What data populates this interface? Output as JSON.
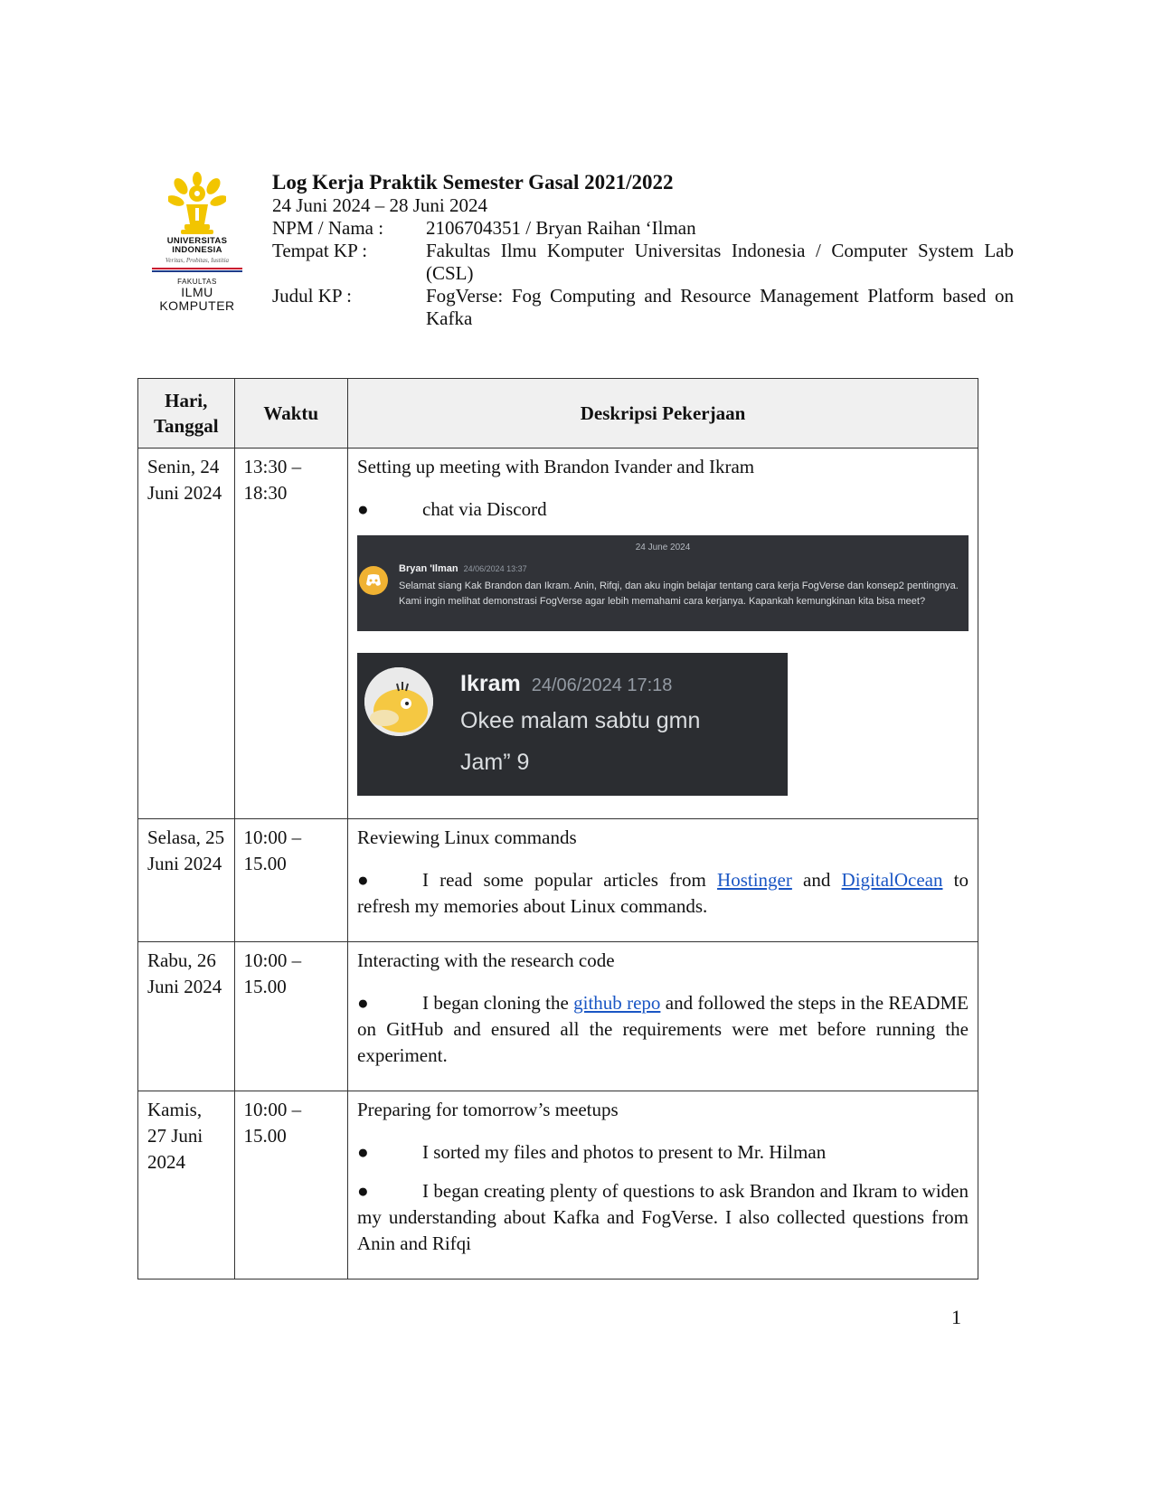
{
  "logo": {
    "university": "UNIVERSITAS INDONESIA",
    "university_line1": "UNIVERSITAS",
    "university_line2": "INDONESIA",
    "motto": "Veritas, Probitas, Iustitia",
    "faculty_small": "FAKULTAS",
    "faculty_line1": "ILMU",
    "faculty_line2": "KOMPUTER"
  },
  "header": {
    "title": "Log Kerja Praktik Semester Gasal 2021/2022",
    "period": "24 Juni 2024 – 28 Juni 2024",
    "npm_label": "NPM / Nama :",
    "npm_value": "2106704351 / Bryan Raihan ‘Ilman",
    "tempat_label": "Tempat KP :",
    "tempat_value": "Fakultas Ilmu Komputer Universitas Indonesia / Computer System Lab (CSL)",
    "judul_label": "Judul KP :",
    "judul_value": "FogVerse: Fog Computing and Resource Management Platform based on Kafka"
  },
  "table": {
    "headers": {
      "day_line1": "Hari,",
      "day_line2": "Tanggal",
      "time": "Waktu",
      "desc": "Deskripsi Pekerjaan"
    },
    "rows": [
      {
        "day": "Senin, 24 Juni 2024",
        "time": "13:30 – 18:30",
        "title": "Setting up meeting with Brandon Ivander and Ikram",
        "bullet1": "chat via Discord"
      },
      {
        "day": "Selasa, 25 Juni 2024",
        "time": "10:00 – 15.00",
        "title": "Reviewing Linux commands",
        "b_pre": "I read some popular articles from ",
        "b_link1": "Hostinger",
        "b_mid": " and ",
        "b_link2": "DigitalOcean",
        "b_post": " to refresh my memories about Linux commands."
      },
      {
        "day": "Rabu, 26 Juni 2024",
        "time": "10:00 – 15.00",
        "title": "Interacting with the research code",
        "b_pre": "I began cloning the ",
        "b_link": "github repo",
        "b_post": " and followed the steps in the README on GitHub and ensured all the requirements were met before running the experiment."
      },
      {
        "day": "Kamis, 27 Juni 2024",
        "time": "10:00 – 15.00",
        "title": "Preparing for tomorrow’s meetups",
        "bullet1": "I sorted my files and photos to present to Mr. Hilman",
        "bullet2": "I began creating plenty of questions to ask Brandon and Ikram to widen my understanding about Kafka and FogVerse. I also collected questions from Anin and Rifqi"
      }
    ],
    "bullet_symbol": "●"
  },
  "discord_msg1": {
    "date_divider": "24 June 2024",
    "author": "Bryan 'Ilman",
    "timestamp": "24/06/2024 13:37",
    "text": "Selamat siang Kak Brandon dan Ikram. Anin, Rifqi, dan aku ingin belajar tentang cara kerja FogVerse dan konsep2 pentingnya. Kami ingin melihat demonstrasi FogVerse agar lebih memahami cara kerjanya. Kapankah kemungkinan kita bisa meet?",
    "avatar_color": "#f0b232"
  },
  "discord_msg2": {
    "author": "Ikram",
    "timestamp": "24/06/2024 17:18",
    "line1": "Okee malam sabtu gmn",
    "line2": "Jam” 9"
  },
  "page_number": "1"
}
